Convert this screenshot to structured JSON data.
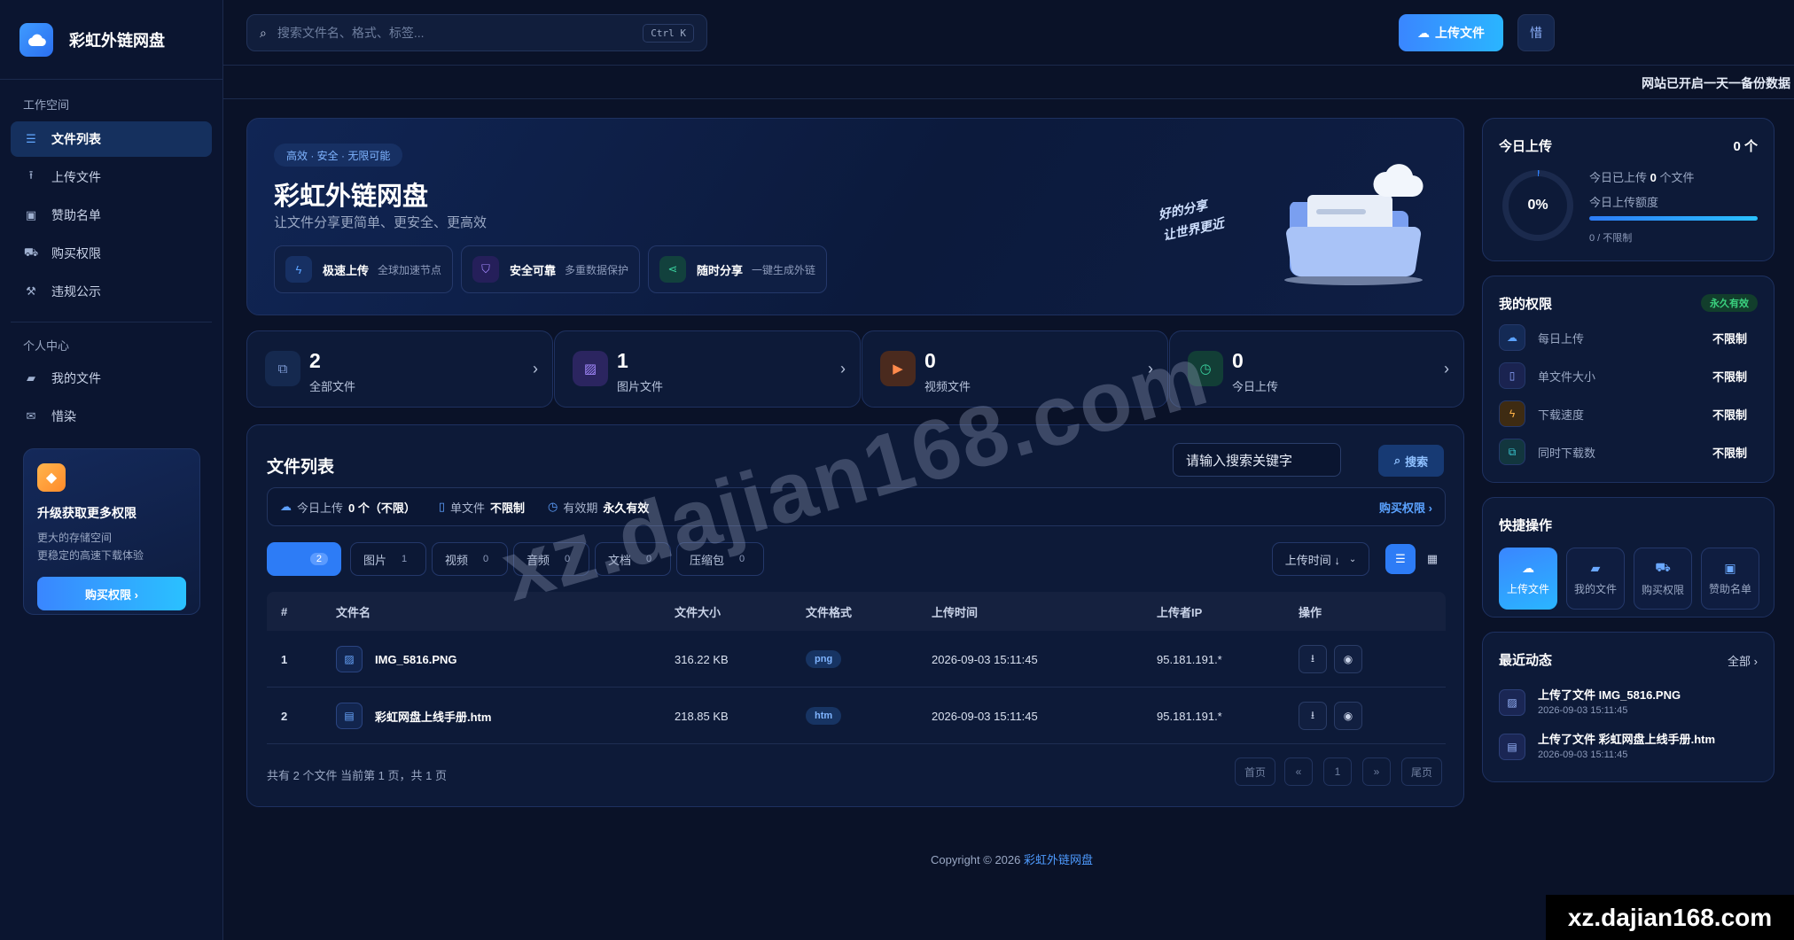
{
  "brand": {
    "name": "彩虹外链网盘"
  },
  "sidebar": {
    "workspace_label": "工作空间",
    "work_items": [
      {
        "label": "文件列表",
        "icon": "list-icon"
      },
      {
        "label": "上传文件",
        "icon": "upload-icon"
      },
      {
        "label": "赞助名单",
        "icon": "money-icon"
      },
      {
        "label": "购买权限",
        "icon": "cart-icon"
      },
      {
        "label": "违规公示",
        "icon": "gavel-icon"
      }
    ],
    "personal_label": "个人中心",
    "personal_items": [
      {
        "label": "我的文件",
        "icon": "folder-icon"
      },
      {
        "label": "惜染",
        "icon": "mail-icon"
      }
    ],
    "promo": {
      "title": "升级获取更多权限",
      "line1": "更大的存储空间",
      "line2": "更稳定的高速下载体验",
      "button": "购买权限 ›"
    }
  },
  "header": {
    "search_placeholder": "搜索文件名、格式、标签...",
    "shortcut": "Ctrl K",
    "upload_label": "上传文件",
    "misc_label": "惜"
  },
  "ticker": {
    "text": "网站已开启一天一备份数据"
  },
  "hero": {
    "tag": "高效 · 安全 · 无限可能",
    "title": "彩虹外链网盘",
    "subtitle": "让文件分享更简单、更安全、更高效",
    "features": [
      {
        "title": "极速上传",
        "desc": "全球加速节点"
      },
      {
        "title": "安全可靠",
        "desc": "多重数据保护"
      },
      {
        "title": "随时分享",
        "desc": "一键生成外链"
      }
    ],
    "slogan1": "好的分享",
    "slogan2": "让世界更近"
  },
  "stats": [
    {
      "value": "2",
      "label": "全部文件"
    },
    {
      "value": "1",
      "label": "图片文件"
    },
    {
      "value": "0",
      "label": "视频文件"
    },
    {
      "value": "0",
      "label": "今日上传"
    }
  ],
  "file_list": {
    "title": "文件列表",
    "search_value": "请输入搜索关键字",
    "search_button": "搜索",
    "quota": {
      "today_label": "今日上传",
      "today_value": "0 个（不限）",
      "single_label": "单文件",
      "single_value": "不限制",
      "validity_label": "有效期",
      "validity_value": "永久有效",
      "buy": "购买权限 ›"
    },
    "filters": [
      {
        "label": "",
        "count": "2"
      },
      {
        "label": "图片",
        "count": "1"
      },
      {
        "label": "视频",
        "count": "0"
      },
      {
        "label": "音频",
        "count": "0"
      },
      {
        "label": "文档",
        "count": "0"
      },
      {
        "label": "压缩包",
        "count": "0"
      }
    ],
    "sort_label": "上传时间 ↓",
    "columns": [
      "#",
      "文件名",
      "文件大小",
      "文件格式",
      "上传时间",
      "上传者IP",
      "操作"
    ],
    "rows": [
      {
        "index": "1",
        "name": "IMG_5816.PNG",
        "size": "316.22 KB",
        "format": "png",
        "time": "2026-09-03 15:11:45",
        "ip": "95.181.191.*"
      },
      {
        "index": "2",
        "name": "彩虹网盘上线手册.htm",
        "size": "218.85 KB",
        "format": "htm",
        "time": "2026-09-03 15:11:45",
        "ip": "95.181.191.*"
      }
    ],
    "footer": "共有 2 个文件  当前第 1 页，共 1 页",
    "pager": {
      "first": "首页",
      "prev": "«",
      "page": "1",
      "next": "»",
      "last": "尾页"
    }
  },
  "today_upload": {
    "title": "今日上传",
    "count": "0 个",
    "percent": "0%",
    "line1_prefix": "今日已上传",
    "line1_value": "0",
    "line1_suffix": "个文件",
    "line2": "今日上传额度",
    "quota_text": "0 / 不限制"
  },
  "permissions": {
    "title": "我的权限",
    "badge": "永久有效",
    "items": [
      {
        "label": "每日上传",
        "value": "不限制"
      },
      {
        "label": "单文件大小",
        "value": "不限制"
      },
      {
        "label": "下载速度",
        "value": "不限制"
      },
      {
        "label": "同时下载数",
        "value": "不限制"
      }
    ]
  },
  "quick_actions": {
    "title": "快捷操作",
    "items": [
      "上传文件",
      "我的文件",
      "购买权限",
      "赞助名单"
    ]
  },
  "recent": {
    "title": "最近动态",
    "all": "全部 ›",
    "items": [
      {
        "text": "上传了文件 IMG_5816.PNG",
        "time": "2026-09-03 15:11:45"
      },
      {
        "text": "上传了文件 彩虹网盘上线手册.htm",
        "time": "2026-09-03 15:11:45"
      }
    ]
  },
  "footer": {
    "copyright": "Copyright © 2026 ",
    "link": "彩虹外链网盘"
  },
  "watermark": {
    "text": "xz.dajian168.com",
    "corner": "xz.dajian168.com"
  },
  "colors": {
    "accent": "#2d7cf6",
    "background": "#0a1228",
    "card": "#0d1a38",
    "success": "#2ecc71"
  }
}
